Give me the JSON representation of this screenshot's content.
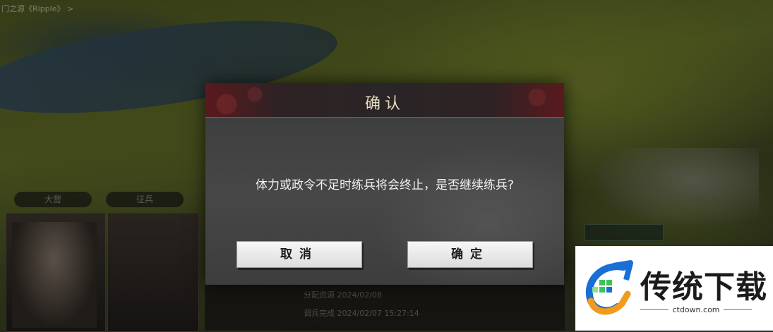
{
  "breadcrumb": "门之源《Ripple》 >",
  "hud": {
    "tab_left": "大营",
    "tab_mid": "征兵",
    "log_line_1": "分配资源 2024/02/08",
    "log_line_2": "调兵完成 2024/02/07 15:27:14"
  },
  "dialog": {
    "title": "确认",
    "message": "体力或政令不足时练兵将会终止，是否继续练兵?",
    "cancel_label": "取消",
    "confirm_label": "确定"
  },
  "watermark": {
    "title": "传统下载",
    "url": "ctdown.com"
  },
  "colors": {
    "header_red": "#5a1a1d",
    "title_text": "#e6d9c0",
    "button_face": "#f2f2f2",
    "logo_blue": "#1a6fd6",
    "logo_orange": "#f29a1a",
    "logo_green": "#3cc25a"
  }
}
